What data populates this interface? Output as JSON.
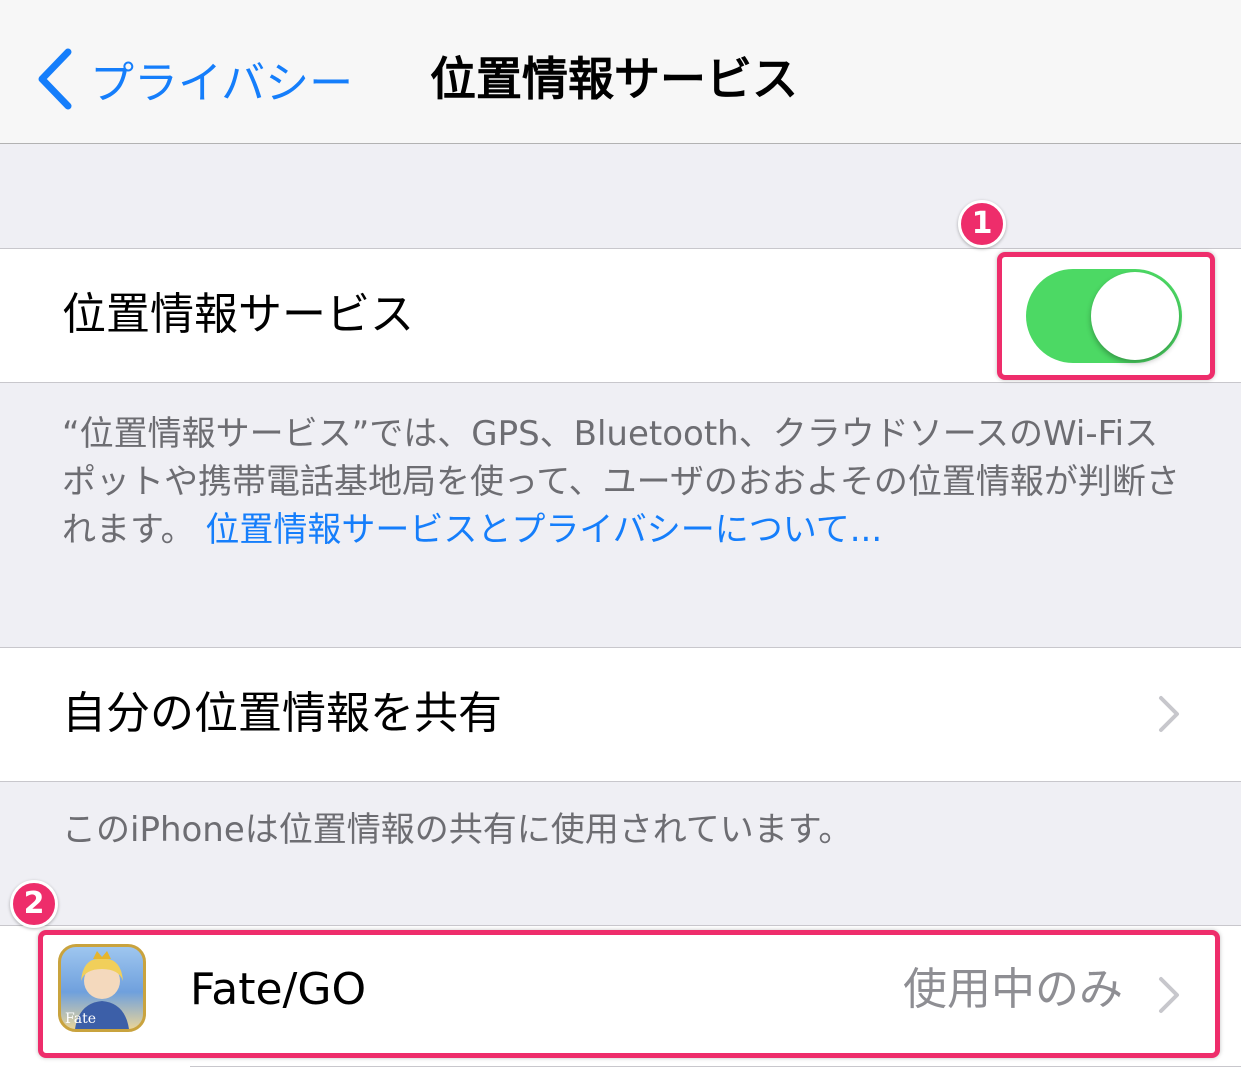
{
  "nav": {
    "back_label": "プライバシー",
    "title": "位置情報サービス"
  },
  "location_services": {
    "label": "位置情報サービス",
    "toggle_on": true,
    "footer_text": "“位置情報サービス”では、GPS、Bluetooth、クラウドソースのWi-Fiスポットや携帯電話基地局を使って、ユーザのおおよその位置情報が判断されます。",
    "footer_link": "位置情報サービスとプライバシーについて..."
  },
  "share_location": {
    "label": "自分の位置情報を共有",
    "footer_text": "このiPhoneは位置情報の共有に使用されています。"
  },
  "apps": [
    {
      "name": "Fate/GO",
      "permission": "使用中のみ",
      "icon": "fate-grand-order-app-icon",
      "icon_text": "Fate"
    }
  ],
  "annotations": {
    "badge_1": "1",
    "badge_2": "2",
    "highlight_color": "#ee2d6b"
  },
  "colors": {
    "accent": "#157efb",
    "toggle_on": "#4cd964",
    "background": "#efeff4"
  }
}
